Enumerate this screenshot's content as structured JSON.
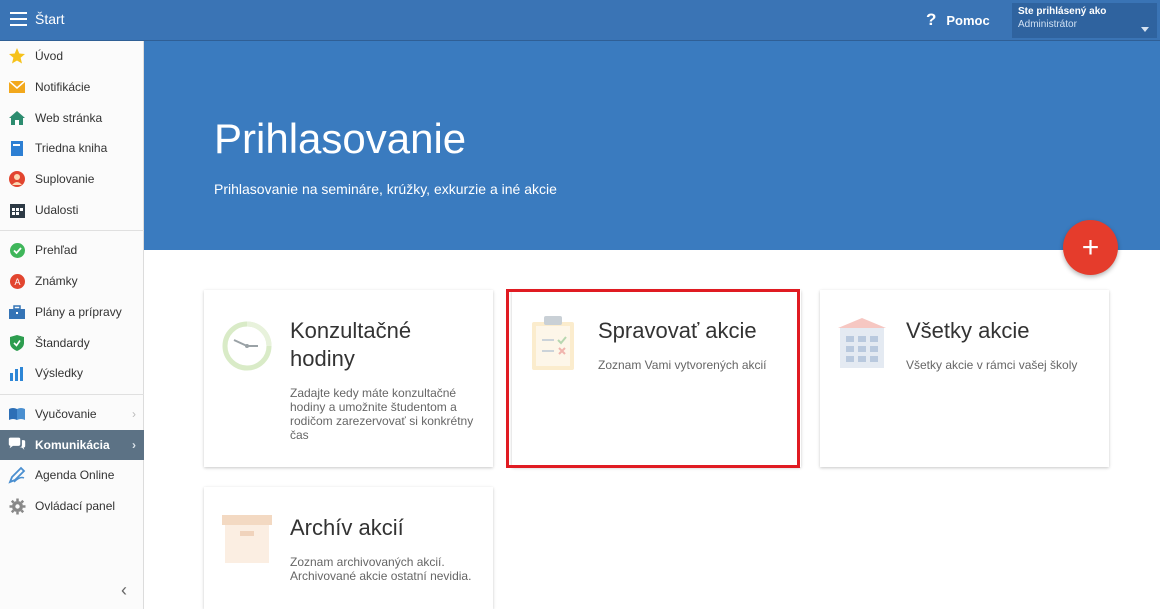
{
  "topbar": {
    "title": "Štart",
    "help_label": "Pomoc",
    "help_icon": "?",
    "user_label": "Ste prihlásený ako",
    "user_name": "Administrátor"
  },
  "sidebar": {
    "items": [
      {
        "label": "Úvod",
        "icon": "star-icon"
      },
      {
        "label": "Notifikácie",
        "icon": "envelope-icon"
      },
      {
        "label": "Web stránka",
        "icon": "home-icon"
      },
      {
        "label": "Triedna kniha",
        "icon": "book-icon"
      },
      {
        "label": "Suplovanie",
        "icon": "substitute-person-icon"
      },
      {
        "label": "Udalosti",
        "icon": "calendar-icon"
      },
      {
        "label": "Prehľad",
        "icon": "check-circle-icon"
      },
      {
        "label": "Známky",
        "icon": "grades-icon"
      },
      {
        "label": "Plány a prípravy",
        "icon": "briefcase-icon"
      },
      {
        "label": "Štandardy",
        "icon": "shield-icon"
      },
      {
        "label": "Výsledky",
        "icon": "bar-chart-icon"
      },
      {
        "label": "Vyučovanie",
        "icon": "open-book-icon"
      },
      {
        "label": "Komunikácia",
        "icon": "chat-icon"
      },
      {
        "label": "Agenda Online",
        "icon": "pencil-icon"
      },
      {
        "label": "Ovládací panel",
        "icon": "gear-icon"
      }
    ],
    "collapse_glyph": "‹"
  },
  "hero": {
    "title": "Prihlasovanie",
    "subtitle": "Prihlasovanie na semináre, krúžky, exkurzie a iné akcie",
    "fab_glyph": "+"
  },
  "cards": [
    {
      "title": "Konzultačné hodiny",
      "desc": "Zadajte kedy máte konzultačné hodiny a umožnite študentom a rodičom zarezervovať si konkrétny čas",
      "icon": "clock-icon"
    },
    {
      "title": "Spravovať akcie",
      "desc": "Zoznam Vami vytvorených akcií",
      "icon": "clipboard-icon"
    },
    {
      "title": "Všetky akcie",
      "desc": "Všetky akcie v rámci vašej školy",
      "icon": "school-building-icon"
    },
    {
      "title": "Archív akcií",
      "desc": "Zoznam archivovaných akcií. Archivované akcie ostatní nevidia.",
      "icon": "archive-box-icon"
    }
  ],
  "colors": {
    "topbar": "#3a74b5",
    "hero": "#3a7bbf",
    "fab": "#e53c2c",
    "active_nav": "#5c7285",
    "highlight": "#e01b22"
  }
}
